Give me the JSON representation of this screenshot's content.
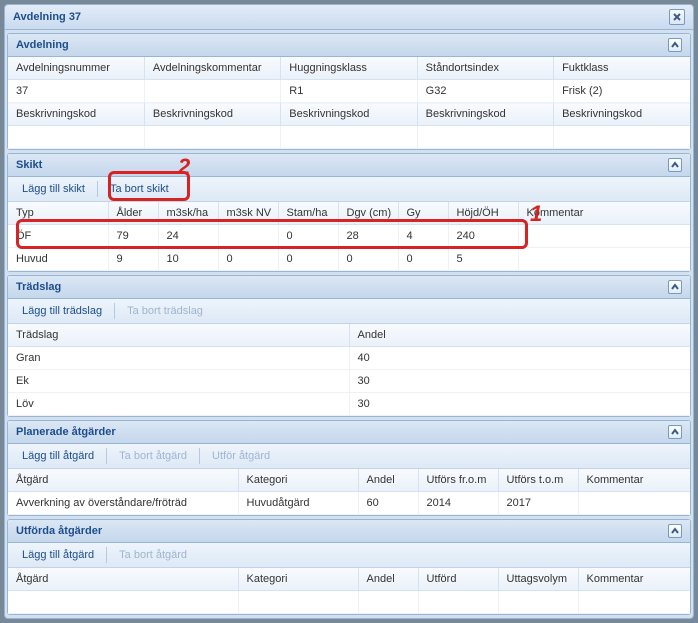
{
  "window": {
    "title": "Avdelning 37"
  },
  "avdelning": {
    "title": "Avdelning",
    "row1_headers": [
      "Avdelningsnummer",
      "Avdelningskommentar",
      "Huggningsklass",
      "Ståndortsindex",
      "Fuktklass"
    ],
    "row1_values": [
      "37",
      "",
      "R1",
      "G32",
      "Frisk (2)"
    ],
    "row2_headers": [
      "Beskrivningskod",
      "Beskrivningskod",
      "Beskrivningskod",
      "Beskrivningskod",
      "Beskrivningskod"
    ]
  },
  "skikt": {
    "title": "Skikt",
    "add": "Lägg till skikt",
    "remove": "Ta bort skikt",
    "headers": [
      "Typ",
      "Ålder",
      "m3sk/ha",
      "m3sk NV",
      "Stam/ha",
      "Dgv (cm)",
      "Gy",
      "Höjd/ÖH",
      "Kommentar"
    ],
    "rows": [
      [
        "ÖF",
        "79",
        "24",
        "",
        "0",
        "28",
        "4",
        "240",
        ""
      ],
      [
        "Huvud",
        "9",
        "10",
        "0",
        "0",
        "0",
        "0",
        "5",
        ""
      ]
    ],
    "annot1": "1",
    "annot2": "2"
  },
  "tradslag": {
    "title": "Trädslag",
    "add": "Lägg till trädslag",
    "remove": "Ta bort trädslag",
    "headers": [
      "Trädslag",
      "Andel"
    ],
    "rows": [
      [
        "Gran",
        "40"
      ],
      [
        "Ek",
        "30"
      ],
      [
        "Löv",
        "30"
      ]
    ]
  },
  "planerade": {
    "title": "Planerade åtgärder",
    "add": "Lägg till åtgärd",
    "remove": "Ta bort åtgärd",
    "exec": "Utför åtgärd",
    "headers": [
      "Åtgärd",
      "Kategori",
      "Andel",
      "Utförs fr.o.m",
      "Utförs t.o.m",
      "Kommentar"
    ],
    "rows": [
      [
        "Avverkning av överståndare/fröträd",
        "Huvudåtgärd",
        "60",
        "2014",
        "2017",
        ""
      ]
    ]
  },
  "utforda": {
    "title": "Utförda åtgärder",
    "add": "Lägg till åtgärd",
    "remove": "Ta bort åtgärd",
    "headers": [
      "Åtgärd",
      "Kategori",
      "Andel",
      "Utförd",
      "Uttagsvolym",
      "Kommentar"
    ]
  }
}
